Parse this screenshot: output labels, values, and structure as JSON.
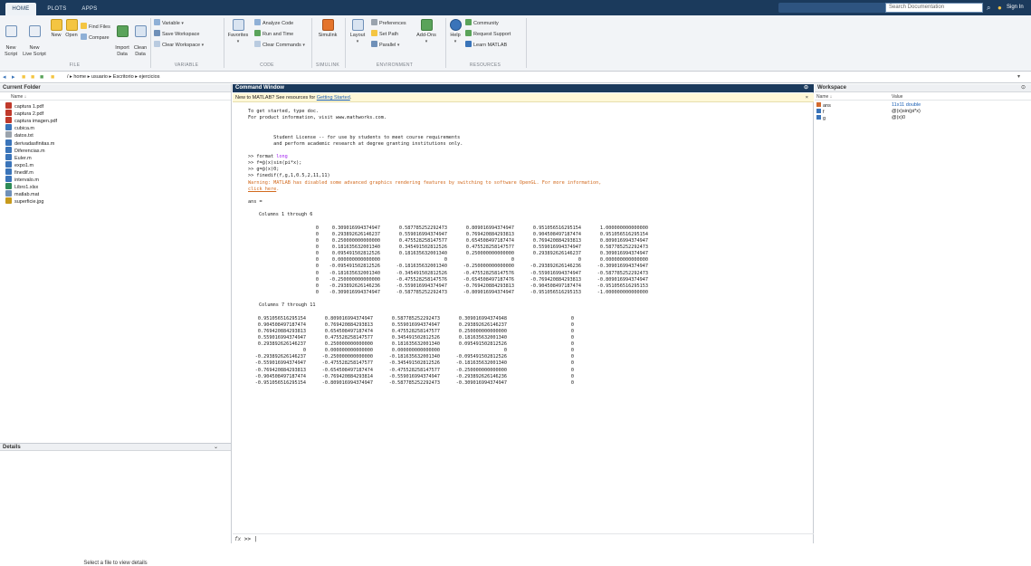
{
  "tabs": [
    "HOME",
    "PLOTS",
    "APPS"
  ],
  "search": {
    "placeholder": "Search Documentation"
  },
  "signin": "Sign In",
  "ribbon": {
    "file": {
      "label": "FILE",
      "new_script": "New\nScript",
      "new_live": "New\nLive Script",
      "new": "New",
      "open": "Open",
      "find_files": "Find Files",
      "compare": "Compare",
      "import": "Import\nData",
      "clean": "Clean\nData"
    },
    "variable": {
      "label": "VARIABLE",
      "variable": "Variable",
      "save_ws": "Save Workspace",
      "clear_ws": "Clear Workspace"
    },
    "code": {
      "label": "CODE",
      "favorites": "Favorites",
      "analyze": "Analyze Code",
      "run_time": "Run and Time",
      "clear_cmds": "Clear Commands"
    },
    "simulink": {
      "label": "SIMULINK",
      "simulink": "Simulink"
    },
    "environment": {
      "label": "ENVIRONMENT",
      "layout": "Layout",
      "preferences": "Preferences",
      "set_path": "Set Path",
      "parallel": "Parallel",
      "addons": "Add-Ons"
    },
    "resources": {
      "label": "RESOURCES",
      "help": "Help",
      "community": "Community",
      "request_support": "Request Support",
      "learn": "Learn MATLAB"
    }
  },
  "address": {
    "path": "/ ▸ home ▸ usuario ▸ Escritorio ▸ ejercicios"
  },
  "current_folder": {
    "title": "Current Folder",
    "col_name": "Name ↓",
    "files": [
      {
        "name": "captura 1.pdf",
        "type": "pdf"
      },
      {
        "name": "captura 2.pdf",
        "type": "pdf"
      },
      {
        "name": "captura imagen.pdf",
        "type": "pdf"
      },
      {
        "name": "cubica.m",
        "type": "m"
      },
      {
        "name": "datos.txt",
        "type": "txt"
      },
      {
        "name": "derivadasfinitas.m",
        "type": "m"
      },
      {
        "name": "Diferencias.m",
        "type": "m"
      },
      {
        "name": "Euler.m",
        "type": "m"
      },
      {
        "name": "expo1.m",
        "type": "m"
      },
      {
        "name": "finedif.m",
        "type": "m"
      },
      {
        "name": "intervalo.m",
        "type": "m"
      },
      {
        "name": "Libro1.xlsx",
        "type": "xlsx"
      },
      {
        "name": "matlab.mat",
        "type": "mat"
      },
      {
        "name": "superficie.jpg",
        "type": "jpg"
      }
    ]
  },
  "details": {
    "title": "Details",
    "message": "Select a file to view details"
  },
  "command_window": {
    "title": "Command Window",
    "info_prefix": "New to MATLAB? See resources for ",
    "info_link": "Getting Started",
    "info_suffix": ".",
    "intro": [
      "To get started, type doc.",
      "For product information, visit www.mathworks.com.",
      "",
      "",
      "         Student License -- for use by students to meet course requirements",
      "         and perform academic research at degree granting institutions only."
    ],
    "commands": {
      "format_prefix": ">> format ",
      "format_arg": "long",
      "line_f": ">> f=@(x)sin(pi*x);",
      "line_g": ">> g=@(x)0;",
      "line_call": ">> finedif(f,g,1,0.5,2,11,11)"
    },
    "warning_text": "Warning: MATLAB has disabled some advanced graphics rendering features by switching to software OpenGL. For more information,",
    "warning_link": "click here",
    "warning_end": ".",
    "ans_label": "ans =",
    "cols_1_6_label": "Columns 1 through 6",
    "cols_7_11_label": "Columns 7 through 11",
    "block1": [
      [
        "0",
        "0.309016994374947",
        "0.587785252292473",
        "0.809016994374947",
        "0.951056516295154",
        "1.000000000000000"
      ],
      [
        "0",
        "0.293892626146237",
        "0.559016994374947",
        "0.769420884293813",
        "0.904508497187474",
        "0.951056516295154"
      ],
      [
        "0",
        "0.250000000000000",
        "0.475528258147577",
        "0.654508497187474",
        "0.769420884293813",
        "0.809016994374947"
      ],
      [
        "0",
        "0.181635632001340",
        "0.345491502812526",
        "0.475528258147577",
        "0.559016994374947",
        "0.587785252292473"
      ],
      [
        "0",
        "0.095491502812526",
        "0.181635632001340",
        "0.250000000000000",
        "0.293892626146237",
        "0.309016994374947"
      ],
      [
        "0",
        "0.000000000000000",
        "0",
        "0",
        "0",
        "0.000000000000000"
      ],
      [
        "0",
        "-0.095491502812526",
        "-0.181635632001340",
        "-0.250000000000000",
        "-0.293892626146236",
        "-0.309016994374947"
      ],
      [
        "0",
        "-0.181635632001340",
        "-0.345491502812526",
        "-0.475528258147576",
        "-0.559016994374947",
        "-0.587785252292473"
      ],
      [
        "0",
        "-0.250000000000000",
        "-0.475528258147576",
        "-0.654508497187476",
        "-0.769420884293813",
        "-0.809016994374947"
      ],
      [
        "0",
        "-0.293892626146236",
        "-0.559016994374947",
        "-0.769420884293813",
        "-0.904508497187474",
        "-0.951056516295153"
      ],
      [
        "0",
        "-0.309016994374947",
        "-0.587785252292473",
        "-0.809016994374947",
        "-0.951056516295153",
        "-1.000000000000000"
      ]
    ],
    "block2": [
      [
        "0.951056516295154",
        "0.809016994374947",
        "0.587785252292473",
        "0.309016994374948",
        "0"
      ],
      [
        "0.904508497187474",
        "0.769420884293813",
        "0.559016994374947",
        "0.293892626146237",
        "0"
      ],
      [
        "0.769420884293813",
        "0.654508497187474",
        "0.475528258147577",
        "0.250000000000000",
        "0"
      ],
      [
        "0.559016994374947",
        "0.475528258147577",
        "0.345491502812526",
        "0.181635632001340",
        "0"
      ],
      [
        "0.293892626146237",
        "0.250000000000000",
        "0.181635632001340",
        "0.095491502812526",
        "0"
      ],
      [
        "0",
        "0.000000000000000",
        "0.000000000000000",
        "0",
        "0"
      ],
      [
        "-0.293892626146237",
        "-0.250000000000000",
        "-0.181635632001340",
        "-0.095491502812526",
        "0"
      ],
      [
        "-0.559016994374947",
        "-0.475528258147577",
        "-0.345491502812526",
        "-0.181635632001340",
        "0"
      ],
      [
        "-0.769420884293813",
        "-0.654508497187474",
        "-0.475528258147577",
        "-0.250000000000000",
        "0"
      ],
      [
        "-0.904508497187474",
        "-0.769420884293814",
        "-0.559016994374947",
        "-0.293892626146236",
        "0"
      ],
      [
        "-0.951056516295154",
        "-0.809016994374947",
        "-0.587785252292473",
        "-0.309016994374947",
        "0"
      ]
    ],
    "prompt": ">> |"
  },
  "workspace": {
    "title": "Workspace",
    "col_name": "Name ↓",
    "col_value": "Value",
    "vars": [
      {
        "name": "ans",
        "value": "11x11 double",
        "icon": "matrix-icon",
        "color": "#1a5fb4"
      },
      {
        "name": "f",
        "value": "@(x)sin(pi*x)",
        "icon": "function-handle-icon",
        "color": "#222222"
      },
      {
        "name": "g",
        "value": "@(x)0",
        "icon": "function-handle-icon",
        "color": "#222222"
      }
    ]
  },
  "colors": {
    "titlebar": "#1b3a5c",
    "info_bg": "#fff8d7",
    "warning": "#d26a1e",
    "keyword": "#a020f0",
    "link": "#1a5fb4"
  }
}
